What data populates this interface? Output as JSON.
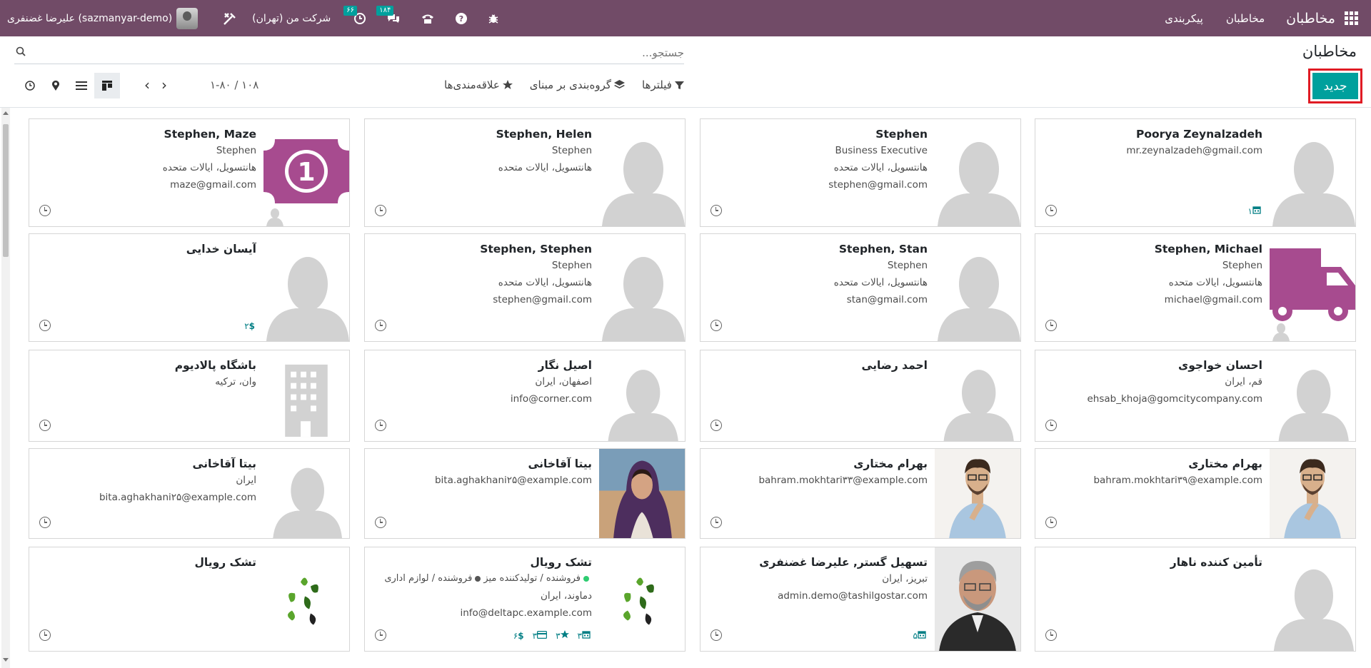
{
  "navbar": {
    "brand": "مخاطبان",
    "menu": [
      "مخاطبان",
      "پیکربندی"
    ],
    "company": "شرکت من (تهران)",
    "user": "علیرضا غضنفری (sazmanyar-demo)",
    "activity_badge": "۶۶",
    "messages_badge": "۱۸۴"
  },
  "page": {
    "title": "مخاطبان",
    "new_button": "جدید",
    "search_placeholder": "جستجو...",
    "filters": "فیلترها",
    "groupby": "گروه‌بندی بر مبنای",
    "favorites": "علاقه‌مندی‌ها",
    "pager_value": "۱-۸۰ / ۱۰۸"
  },
  "cards": [
    {
      "name": "Poorya Zeynalzadeh",
      "lines": [
        "mr.zeynalzadeh@gmail.com"
      ],
      "stats": [
        {
          "icon": "calendar-icon",
          "value": "۱"
        }
      ],
      "image": "person"
    },
    {
      "name": "Stephen",
      "lines": [
        "Business Executive",
        "هانتسویل، ایالات متحده",
        "stephen@gmail.com"
      ],
      "stats": [],
      "image": "person"
    },
    {
      "name": "Stephen, Helen",
      "lines": [
        "Stephen",
        "هانتسویل، ایالات متحده"
      ],
      "stats": [],
      "image": "person-small"
    },
    {
      "name": "Stephen, Maze",
      "lines": [
        "Stephen",
        "هانتسویل، ایالات متحده",
        "maze@gmail.com"
      ],
      "stats": [],
      "image": "money"
    },
    {
      "name": "Stephen, Michael",
      "lines": [
        "Stephen",
        "هانتسویل، ایالات متحده",
        "michael@gmail.com"
      ],
      "stats": [],
      "image": "truck"
    },
    {
      "name": "Stephen, Stan",
      "lines": [
        "Stephen",
        "هانتسویل، ایالات متحده",
        "stan@gmail.com"
      ],
      "stats": [],
      "image": "person-small"
    },
    {
      "name": "Stephen, Stephen",
      "lines": [
        "Stephen",
        "هانتسویل، ایالات متحده",
        "stephen@gmail.com"
      ],
      "stats": [],
      "image": "person-small"
    },
    {
      "name": "آیسان خدایی",
      "lines": [],
      "stats": [
        {
          "icon": "dollar-icon",
          "value": "۲"
        }
      ],
      "image": "person"
    },
    {
      "name": "احسان خواجوی",
      "lines": [
        "قم، ایران",
        "ehsab_khoja@gomcitycompany.com"
      ],
      "stats": [],
      "image": "person"
    },
    {
      "name": "احمد رضایی",
      "lines": [],
      "stats": [],
      "image": "person"
    },
    {
      "name": "اصیل نگار",
      "lines": [
        "اصفهان، ایران",
        "info@corner.com"
      ],
      "stats": [],
      "image": "person"
    },
    {
      "name": "باشگاه پالادیوم",
      "lines": [
        "وان، ترکیه"
      ],
      "stats": [],
      "image": "building"
    },
    {
      "name": "بهرام مختاری",
      "lines": [
        "bahram.mokhtari۳۹@example.com"
      ],
      "stats": [],
      "image": "man-photo"
    },
    {
      "name": "بهرام مختاری",
      "lines": [
        "bahram.mokhtari۳۳@example.com"
      ],
      "stats": [],
      "image": "man-photo"
    },
    {
      "name": "بیتا آقاخانی",
      "lines": [
        "bita.aghakhani۲۵@example.com"
      ],
      "stats": [],
      "image": "woman-photo"
    },
    {
      "name": "بیتا آقاخانی",
      "lines": [
        "ایران",
        "bita.aghakhani۲۵@example.com"
      ],
      "stats": [],
      "image": "person"
    },
    {
      "name": "تأمین کننده ناهار",
      "lines": [],
      "stats": [],
      "image": "person"
    },
    {
      "name": "تسهیل گستر, علیرضا غضنفری",
      "lines": [
        "تبریز، ایران",
        "admin.demo@tashilgostar.com"
      ],
      "stats": [
        {
          "icon": "calendar-icon",
          "value": "۵"
        }
      ],
      "image": "gray-man-photo"
    },
    {
      "name": "تشک رویال",
      "lines": [
        "دماوند، ایران",
        "info@deltapc.example.com"
      ],
      "tags": [
        {
          "label": "فروشنده / تولیدکننده میز",
          "color": "#2ecc71"
        },
        {
          "label": "فروشنده / لوازم اداری",
          "color": "#555555"
        }
      ],
      "stats": [
        {
          "icon": "calendar-icon",
          "value": "۳"
        },
        {
          "icon": "star-icon",
          "value": "۳"
        },
        {
          "icon": "card-icon",
          "value": "۳"
        },
        {
          "icon": "dollar-icon",
          "value": "۶"
        }
      ],
      "image": "leaf-logo"
    },
    {
      "name": "تشک رویال",
      "lines": [],
      "stats": [],
      "image": "leaf-logo"
    }
  ]
}
